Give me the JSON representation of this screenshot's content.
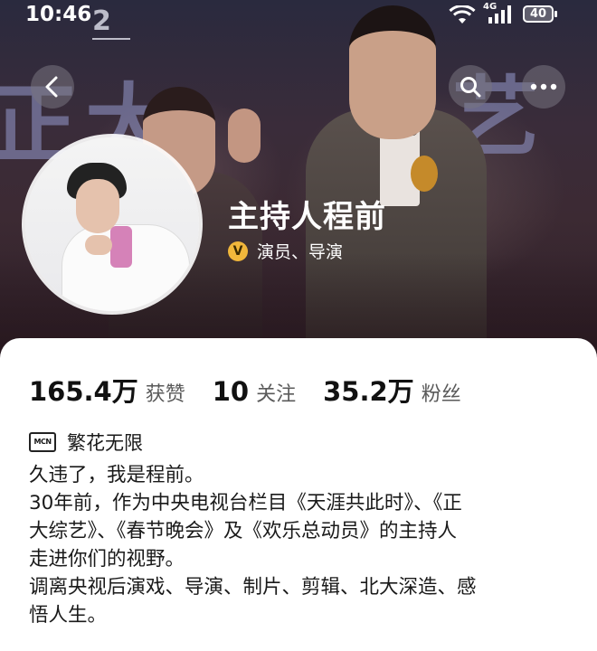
{
  "status_bar": {
    "time": "10:46",
    "channel_mark": "2",
    "network_label": "4G",
    "battery": "40"
  },
  "cover": {
    "backdrop_text_left": "正大",
    "backdrop_text_right": "艺"
  },
  "profile": {
    "name": "主持人程前",
    "verified_badge": "V",
    "role": "演员、导演",
    "accent_color": "#f1b73b"
  },
  "stats": [
    {
      "value": "165.4万",
      "label": "获赞"
    },
    {
      "value": "10",
      "label": "关注"
    },
    {
      "value": "35.2万",
      "label": "粉丝"
    }
  ],
  "mcn": {
    "badge": "MCN",
    "name": "繁花无限"
  },
  "bio_lines": [
    "久违了，我是程前。",
    "30年前，作为中央电视台栏目《天涯共此时》、《正",
    "大综艺》、《春节晚会》及《欢乐总动员》的主持人",
    "走进你们的视野。",
    "调离央视后演戏、导演、制片、剪辑、北大深造、感",
    "悟人生。"
  ],
  "icons": {
    "back": "chevron-left-icon",
    "search": "search-icon",
    "more": "more-dots-icon"
  }
}
